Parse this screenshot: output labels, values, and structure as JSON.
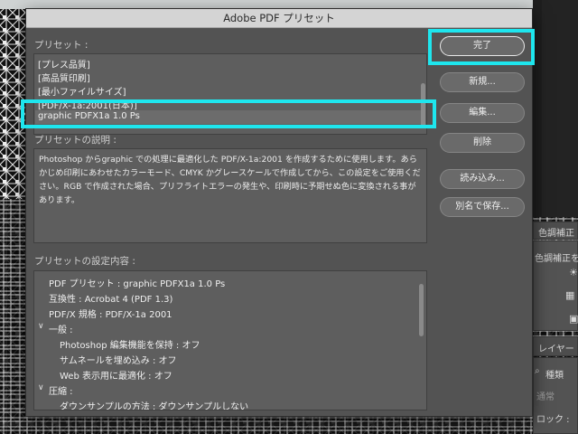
{
  "dialog": {
    "title": "Adobe PDF プリセット",
    "preset_label": "プリセット :",
    "presets": [
      "[プレス品質]",
      "[高品質印刷]",
      "[最小ファイルサイズ]",
      "[PDF/X-1a:2001(日本)]",
      "graphic PDFX1a 1.0 Ps"
    ],
    "selected_preset_index": 4,
    "description_label": "プリセットの説明 :",
    "description": "Photoshop からgraphic での処理に最適化した PDF/X-1a:2001 を作成するために使用します。あらかじめ印刷にあわせたカラーモード、CMYK かグレースケールで作成してから、この設定をご使用ください。RGB で作成された場合、プリフライトエラーの発生や、印刷時に予期せぬ色に変換される事があります。",
    "settings_label": "プリセットの設定内容 :",
    "settings": [
      {
        "text": "PDF プリセット : graphic PDFX1a 1.0 Ps",
        "expander": false
      },
      {
        "text": "互換性 : Acrobat 4 (PDF 1.3)",
        "expander": false
      },
      {
        "text": "PDF/X 規格 : PDF/X-1a 2001",
        "expander": false
      },
      {
        "text": "一般 :",
        "expander": true
      },
      {
        "text": "Photoshop 編集機能を保持 : オフ",
        "expander": false
      },
      {
        "text": "サムネールを埋め込み : オフ",
        "expander": false
      },
      {
        "text": "Web 表示用に最適化 : オフ",
        "expander": false
      },
      {
        "text": "圧縮 :",
        "expander": true
      },
      {
        "text": "ダウンサンプルの方法 : ダウンサンプルしない",
        "expander": false
      }
    ],
    "buttons": {
      "done": "完了",
      "new": "新規...",
      "edit": "編集...",
      "delete": "削除",
      "load": "読み込み...",
      "save_as": "別名で保存..."
    }
  },
  "right_panel": {
    "adjustments_tab": "色調補正",
    "add_adjustment": "色調補正を追加",
    "layers_tab": "レイヤー",
    "kind_filter": "種類",
    "blend_mode": "通常",
    "lock_label": "ロック :"
  },
  "colors": {
    "highlight": "#1ee6ee",
    "dialog_bg": "#535353",
    "list_bg": "#5e5e5e"
  }
}
